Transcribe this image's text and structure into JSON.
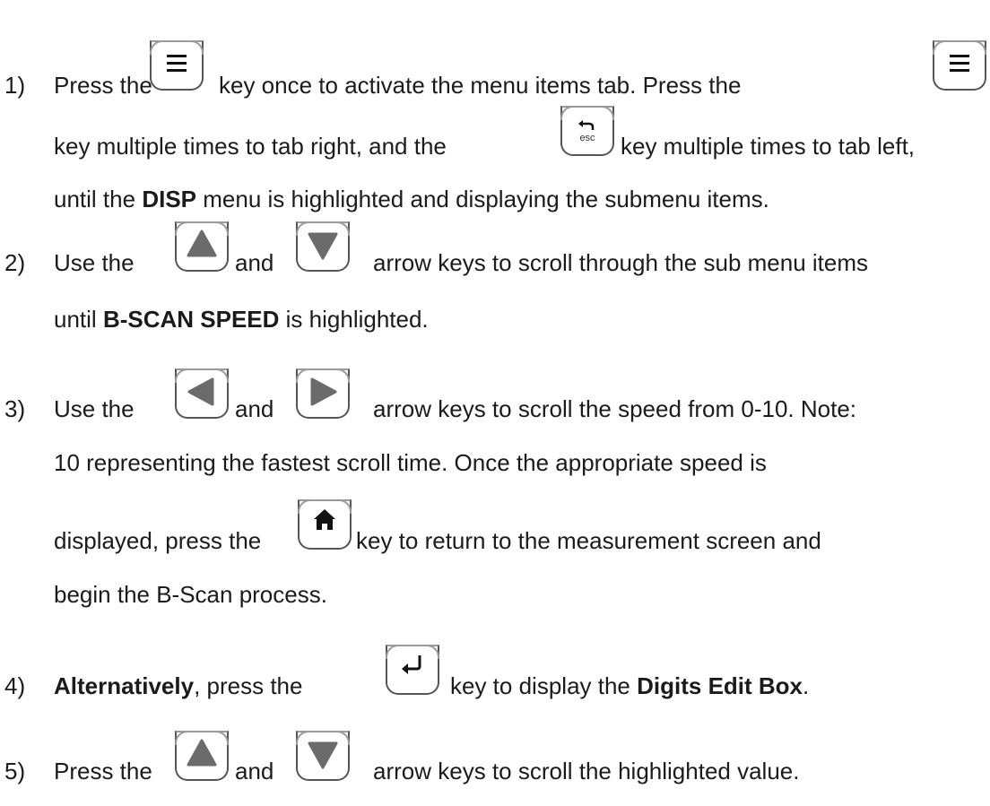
{
  "steps": [
    {
      "num": "1)",
      "line1": {
        "a": "Press the",
        "b": "key once to activate the menu items tab.  Press the"
      },
      "line2": {
        "a": "key multiple times to tab right, and the",
        "b": "key multiple times to tab left,"
      },
      "line3": {
        "a": "until the",
        "bold": "DISP",
        "b": "menu is highlighted and displaying the submenu items."
      }
    },
    {
      "num": "2)",
      "line1": {
        "a": "Use the",
        "b": "and",
        "c": "arrow keys to scroll through the sub menu items"
      },
      "line2": {
        "a": "until",
        "bold": "B-SCAN SPEED",
        "b": "is highlighted."
      }
    },
    {
      "num": "3)",
      "line1": {
        "a": "Use the",
        "b": "and",
        "c": "arrow keys to scroll the speed from 0-10.  Note:"
      },
      "line2": "10 representing the fastest scroll time.  Once the appropriate speed is",
      "line3": {
        "a": "displayed, press the",
        "b": "key to return to the measurement screen and"
      },
      "line4": "begin the B-Scan process."
    },
    {
      "num": "4)",
      "line1": {
        "bold1": "Alternatively",
        "a": ", press the",
        "b": "key to display the",
        "bold2": "Digits Edit Box",
        "c": "."
      }
    },
    {
      "num": "5)",
      "line1": {
        "a": "Press the",
        "b": "and",
        "c": "arrow keys to scroll the highlighted value."
      }
    }
  ],
  "keys": {
    "menu": "menu-icon",
    "esc": "esc",
    "esc_icon": "back-arrow-icon",
    "up": "up-arrow-icon",
    "down": "down-arrow-icon",
    "left": "left-arrow-icon",
    "right": "right-arrow-icon",
    "home": "home-icon",
    "enter": "enter-icon"
  }
}
